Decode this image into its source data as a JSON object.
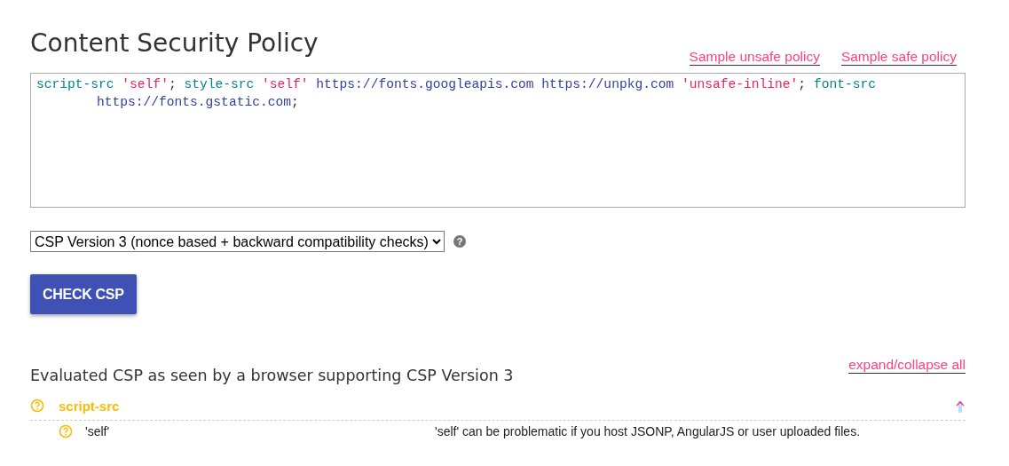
{
  "title": "Content Security Policy",
  "sample_links": [
    "Sample unsafe policy",
    "Sample safe policy"
  ],
  "policy_tokens": [
    {
      "text": "script-src",
      "kind": "directive"
    },
    {
      "text": "'self'",
      "kind": "keyword"
    },
    {
      "text": ";",
      "kind": "punct"
    },
    {
      "text": "style-src",
      "kind": "directive"
    },
    {
      "text": "'self'",
      "kind": "keyword"
    },
    {
      "text": "https://fonts.googleapis.com",
      "kind": "url"
    },
    {
      "text": "https://unpkg.com",
      "kind": "url"
    },
    {
      "text": "'unsafe-inline'",
      "kind": "keyword"
    },
    {
      "text": ";",
      "kind": "punct"
    },
    {
      "text": "font-src",
      "kind": "directive"
    },
    {
      "text": "https://fonts.gstatic.com",
      "kind": "url"
    },
    {
      "text": ";",
      "kind": "punct"
    }
  ],
  "version_select": {
    "value": "CSP Version 3 (nonce based + backward compatibility checks)"
  },
  "help_icon_char": "?",
  "check_button": "CHECK CSP",
  "results": {
    "heading": "Evaluated CSP as seen by a browser supporting CSP Version 3",
    "expand_link": "expand/collapse all",
    "directives": [
      {
        "name": "script-src",
        "expanded": true,
        "findings": [
          {
            "value": "'self'",
            "message": "'self' can be problematic if you host JSONP, AngularJS or user uploaded files."
          }
        ]
      }
    ]
  }
}
